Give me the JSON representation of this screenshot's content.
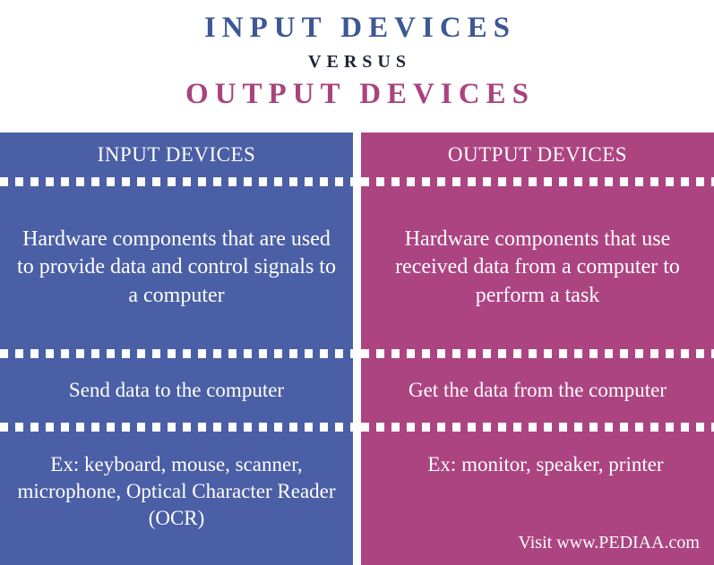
{
  "title": {
    "line1": "INPUT DEVICES",
    "versus": "VERSUS",
    "line2": "OUTPUT DEVICES",
    "color_input": "#3E5795",
    "color_output": "#A9437E",
    "color_versus": "#1E2433"
  },
  "comparison": {
    "left": {
      "header": "INPUT DEVICES",
      "accent_color": "#4A5FA5",
      "definition": "Hardware components that are used to provide data and control signals to a computer",
      "function": "Send data to the computer",
      "examples": "Ex: keyboard, mouse, scanner, microphone, Optical Character Reader (OCR)"
    },
    "right": {
      "header": "OUTPUT DEVICES",
      "accent_color": "#AD4482",
      "definition": "Hardware components that use received data from a computer to perform a task",
      "function": "Get the data from the computer",
      "examples": "Ex: monitor, speaker, printer"
    }
  },
  "footer": {
    "attribution": "Visit www.PEDIAA.com"
  }
}
